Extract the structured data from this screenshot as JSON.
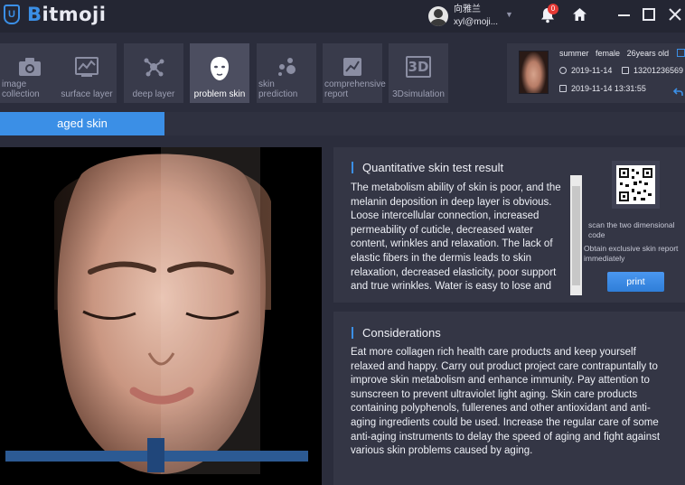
{
  "app": {
    "logo_letter": "U",
    "logo_first": "B",
    "logo_rest": "itmoji"
  },
  "user": {
    "name": "向雅兰",
    "email": "xyl@moji..."
  },
  "notifications": {
    "count": "0"
  },
  "tabs": [
    {
      "label": "image collection",
      "icon": "camera-icon"
    },
    {
      "label": "surface layer",
      "icon": "surface-chart-icon"
    },
    {
      "label": "deep layer",
      "icon": "molecule-icon"
    },
    {
      "label": "problem skin",
      "icon": "face-mask-icon"
    },
    {
      "label": "skin prediction",
      "icon": "dots-icon"
    },
    {
      "label": "comprehensive report",
      "icon": "report-icon"
    },
    {
      "label": "3Dsimulation",
      "icon": "3d-icon"
    }
  ],
  "tab_icon_text": {
    "3d": "3D"
  },
  "profile": {
    "season": "summer",
    "gender": "female",
    "age": "26years old",
    "date": "2019-11-14",
    "phone": "13201236569",
    "datetime": "2019-11-14 13:31:55"
  },
  "subtab": {
    "label": "aged skin"
  },
  "result": {
    "title": "Quantitative skin test result",
    "text": "The metabolism ability of skin is poor, and the melanin deposition in deep layer is obvious. Loose intercellular connection, increased permeability of cuticle, decreased water content, wrinkles and relaxation. The lack of elastic fibers in the dermis leads to skin relaxation, decreased elasticity, poor support and true wrinkles. Water is easy to lose and",
    "scan_text": "scan the two dimensional code",
    "report_text": "Obtain exclusive skin report immediately",
    "print_label": "print"
  },
  "considerations": {
    "title": "Considerations",
    "text": "Eat more collagen rich health care products and keep yourself relaxed and happy. Carry out product project care contrapuntally to improve skin metabolism and enhance immunity. Pay attention to sunscreen to prevent ultraviolet light aging. Skin care products containing polyphenols, fullerenes and other antioxidant and anti-aging ingredients could be used. Increase the regular care of some anti-aging instruments to delay the speed of aging and fight against various skin problems caused by aging."
  },
  "colors": {
    "accent": "#3b8fe6",
    "background": "#2b2d3c",
    "panel": "#343645",
    "badge": "#e53935"
  }
}
